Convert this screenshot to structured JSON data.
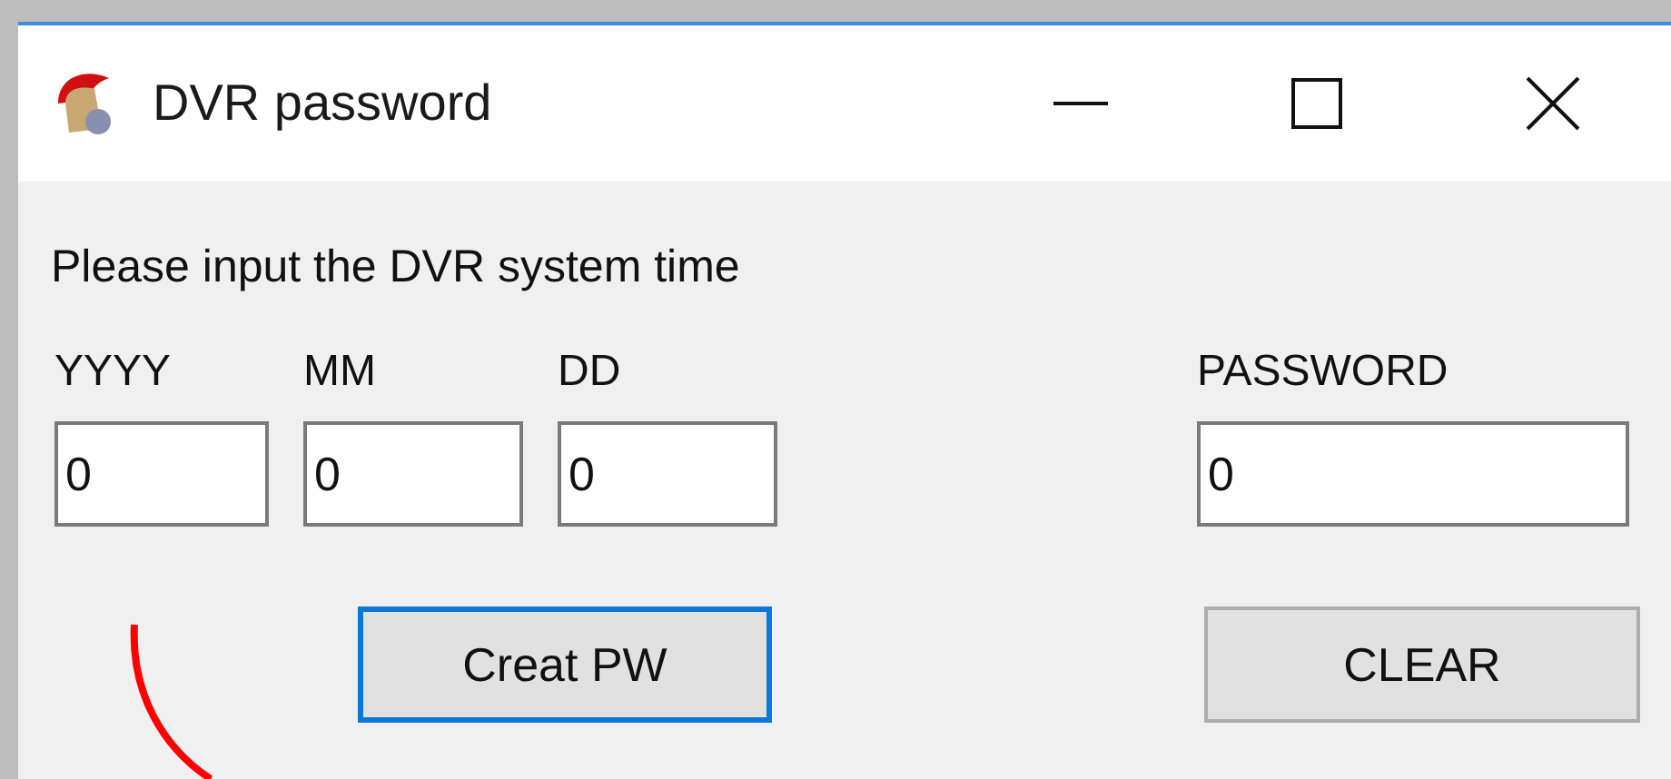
{
  "window": {
    "title": "DVR password"
  },
  "prompt": "Please input the DVR system time",
  "fields": [
    {
      "label": "YYYY",
      "value": "0"
    },
    {
      "label": "MM",
      "value": "0"
    },
    {
      "label": "DD",
      "value": "0"
    },
    {
      "label": "PASSWORD",
      "value": "0"
    }
  ],
  "buttons": [
    {
      "label": "Creat PW",
      "focused": true
    },
    {
      "label": "CLEAR",
      "focused": false
    }
  ]
}
